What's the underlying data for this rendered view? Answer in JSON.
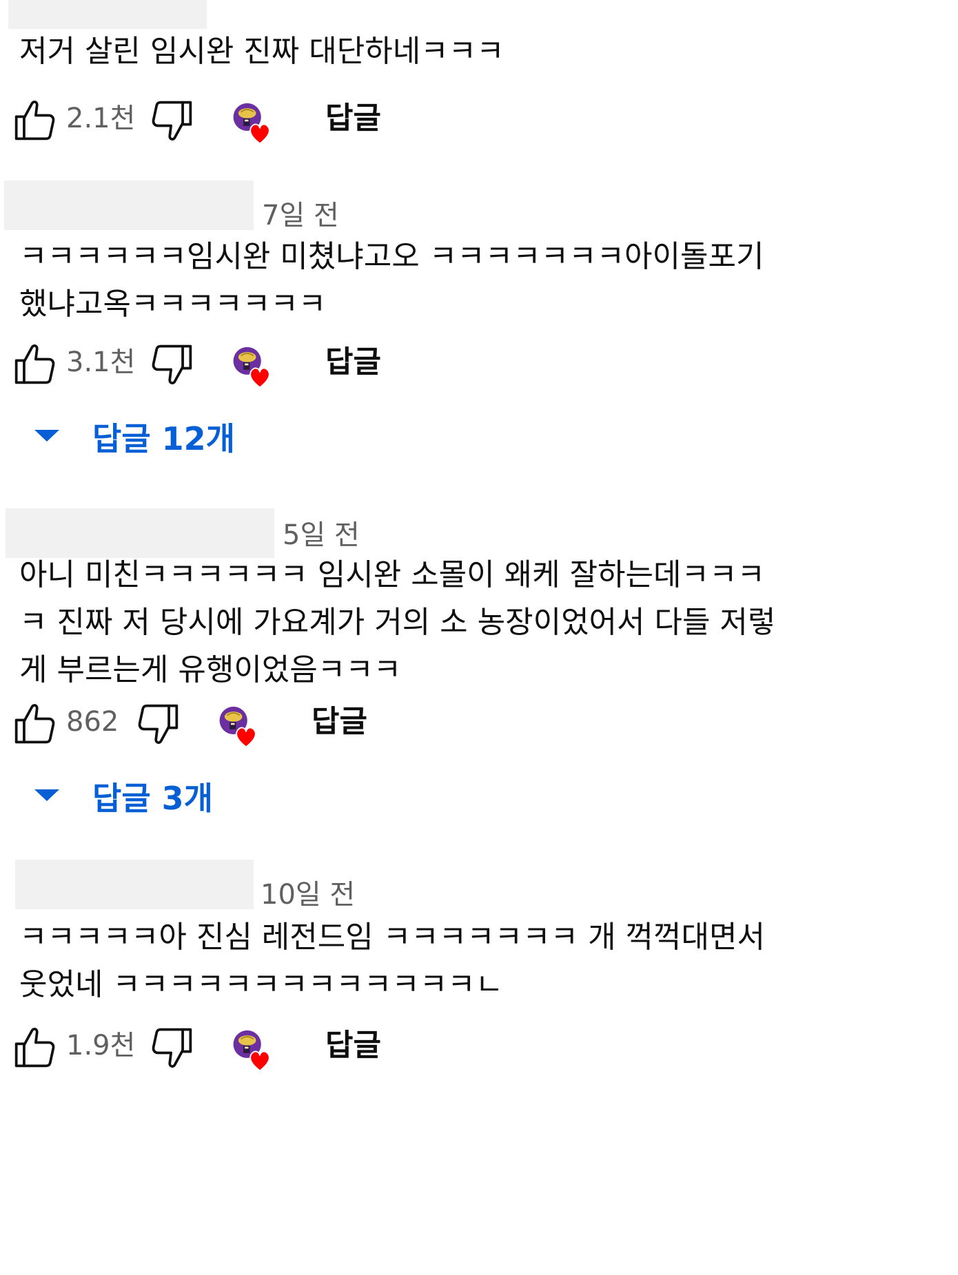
{
  "comments": [
    {
      "time": "",
      "text": "저거 살린 임시완 진짜 대단하네ㅋㅋㅋ",
      "likes": "2.1천",
      "reply_label": "답글"
    },
    {
      "time": "7일 전",
      "text": "ㅋㅋㅋㅋㅋㅋ임시완 미쳤냐고오 ㅋㅋㅋㅋㅋㅋㅋ아이돌포기\n했냐고옥ㅋㅋㅋㅋㅋㅋㅋ",
      "likes": "3.1천",
      "reply_label": "답글",
      "replies_toggle": "답글 12개"
    },
    {
      "time": "5일 전",
      "text": "아니 미친ㅋㅋㅋㅋㅋㅋ 임시완 소몰이 왜케 잘하는데ㅋㅋㅋ\nㅋ 진짜 저 당시에 가요계가 거의 소 농장이었어서 다들 저렇\n게 부르는게 유행이었음ㅋㅋㅋ",
      "likes": "862",
      "reply_label": "답글",
      "replies_toggle": "답글 3개"
    },
    {
      "time": "10일 전",
      "text": "ㅋㅋㅋㅋㅋ아 진심 레전드임 ㅋㅋㅋㅋㅋㅋㅋ 개 꺽꺽대면서\n웃었네 ㅋㅋㅋㅋㅋㅋㅋㅋㅋㅋㅋㅋㅋㄴ",
      "likes": "1.9천",
      "reply_label": "답글"
    }
  ],
  "colors": {
    "link_blue": "#065fd4",
    "secondary_text": "#606060",
    "heart_red": "#ff0000",
    "avatar_purple": "#6b2fa0"
  },
  "icons": [
    "like-icon",
    "dislike-icon",
    "creator-heart-icon",
    "expand-caret-icon"
  ]
}
